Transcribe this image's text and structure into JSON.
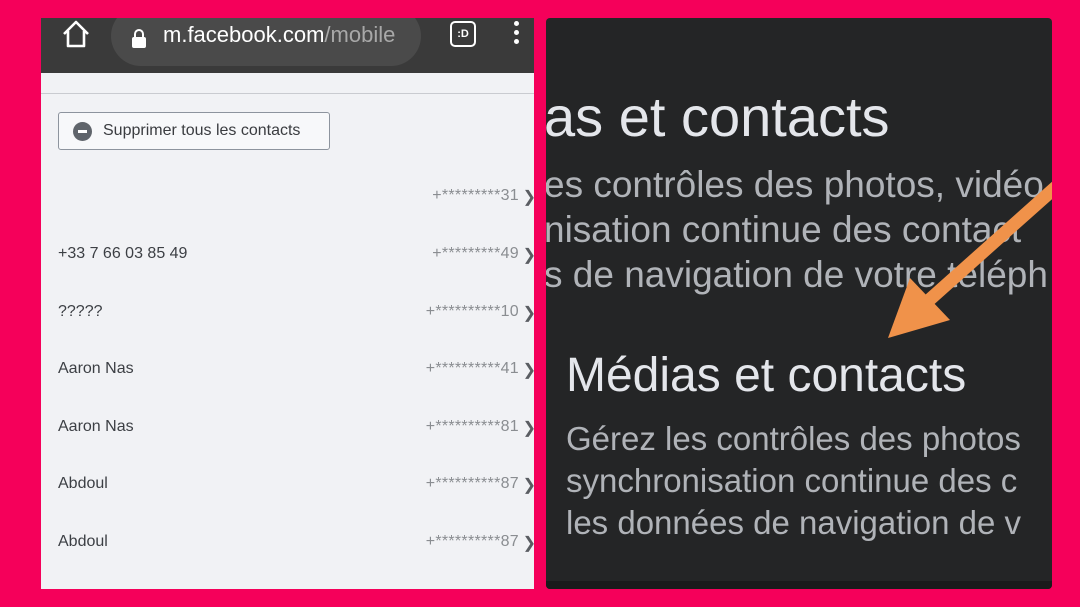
{
  "browser": {
    "url_domain": "m.facebook.com",
    "url_path": "/mobile",
    "extension_label": ":D"
  },
  "actions": {
    "delete_all_label": "Supprimer tous les contacts"
  },
  "contacts": [
    {
      "name": "",
      "number": "+*********31"
    },
    {
      "name": "+33 7 66 03 85 49",
      "number": "+*********49"
    },
    {
      "name": "?????",
      "number": "+**********10"
    },
    {
      "name": "Aaron Nas",
      "number": "+**********41"
    },
    {
      "name": "Aaron Nas",
      "number": "+**********81"
    },
    {
      "name": "Abdoul",
      "number": "+**********87"
    },
    {
      "name": "Abdoul",
      "number": "+**********87"
    }
  ],
  "zoom_panel": {
    "cropped_title": "as et contacts",
    "cropped_lines": [
      "es contrôles des photos, vidéo",
      "nisation continue des contact",
      "s de navigation de votre téléph"
    ],
    "section_title": "Médias et contacts",
    "section_lines": [
      "Gérez les contrôles des photos",
      "synchronisation continue des c",
      "les données de navigation de v"
    ]
  },
  "colors": {
    "background": "#f5005a",
    "arrow": "#f0924a",
    "dark_panel": "#242526"
  },
  "icons": {
    "home": "home-icon",
    "lock": "lock-icon",
    "menu": "more-vert-icon",
    "delete": "minus-circle-icon"
  }
}
